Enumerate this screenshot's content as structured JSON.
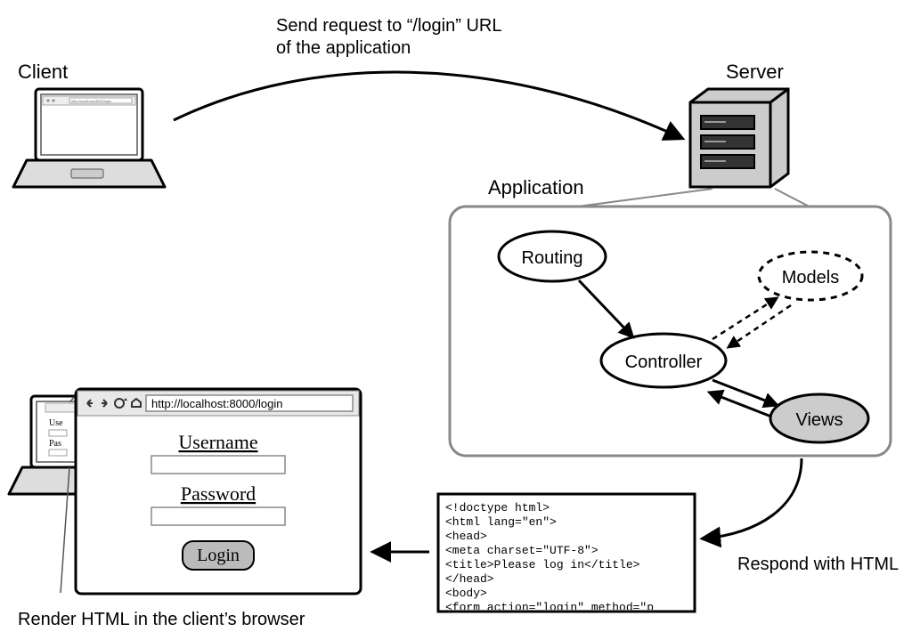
{
  "labels": {
    "client": "Client",
    "server": "Server",
    "application": "Application",
    "routing": "Routing",
    "controller": "Controller",
    "models": "Models",
    "views": "Views",
    "sendRequestLine1": "Send request to “/login” URL",
    "sendRequestLine2": "of the application",
    "respond": "Respond with HTML",
    "render": "Render HTML in the client’s browser",
    "urlSmall": "http://localhost:8000/login",
    "urlBig": "http://localhost:8000/login",
    "formUsername": "Username",
    "formPassword": "Password",
    "loginBtn": "Login",
    "smallUser": "Use",
    "smallPass": "Pas"
  },
  "htmlSnippet": {
    "l1": "<!doctype html>",
    "l2": "<html lang=\"en\">",
    "l3": "  <head>",
    "l4": "    <meta charset=\"UTF-8\">",
    "l5": "    <title>Please log in</title>",
    "l6": "  </head>",
    "l7": "  <body>",
    "l8": "    <form action=\"login\" method=\"p"
  }
}
